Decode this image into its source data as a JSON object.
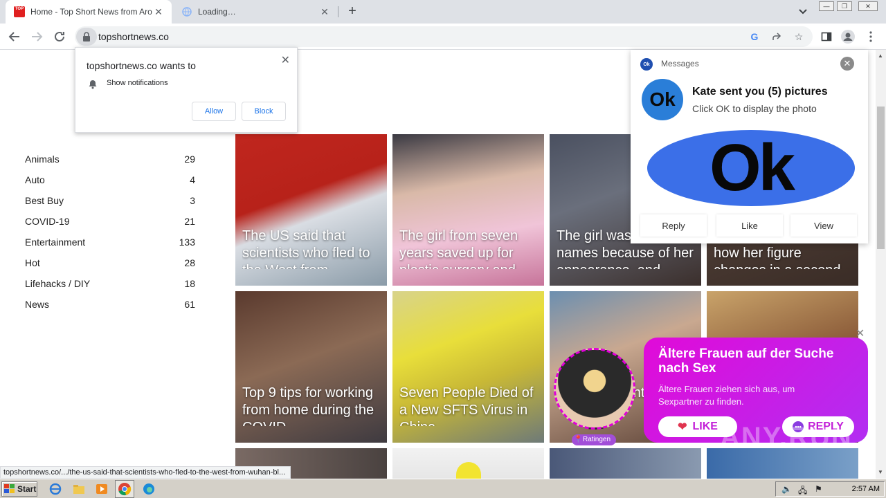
{
  "browser": {
    "tabs": [
      {
        "title": "Home - Top Short News from Around",
        "favicon_text": "TOP"
      },
      {
        "title": "Loading…"
      }
    ],
    "url": "topshortnews.co",
    "status_url": "topshortnews.co/.../the-us-said-that-scientists-who-fled-to-the-west-from-wuhan-bl..."
  },
  "notification_prompt": {
    "title": "topshortnews.co wants to",
    "permission": "Show notifications",
    "allow_label": "Allow",
    "block_label": "Block"
  },
  "categories": [
    {
      "name": "Animals",
      "count": "29"
    },
    {
      "name": "Auto",
      "count": "4"
    },
    {
      "name": "Best Buy",
      "count": "3"
    },
    {
      "name": "COVID-19",
      "count": "21"
    },
    {
      "name": "Entertainment",
      "count": "133"
    },
    {
      "name": "Hot",
      "count": "28"
    },
    {
      "name": "Lifehacks / DIY",
      "count": "18"
    },
    {
      "name": "News",
      "count": "61"
    }
  ],
  "tiles": [
    {
      "caption": "The US said that scientists who fled to the West from"
    },
    {
      "caption": "The girl from seven years saved up for plastic surgery and"
    },
    {
      "caption": "The girl was called names because of her appearance, and"
    },
    {
      "caption": "The blogger showed how her figure changes in a second"
    },
    {
      "caption": "Top 9 tips for working from home during the COVID"
    },
    {
      "caption": "Seven People Died of a New SFTS Virus in China"
    },
    {
      "caption": "Wo... but wanted to"
    },
    {
      "caption": ""
    }
  ],
  "messages_popup": {
    "header": "Messages",
    "avatar_text": "Ok",
    "title": "Kate sent you (5) pictures",
    "subtitle": "Click OK to display the photo",
    "banner_text": "Ok",
    "actions": [
      "Reply",
      "Like",
      "View"
    ]
  },
  "pink_ad": {
    "title": "Ältere Frauen auf der Suche nach Sex",
    "subtitle": "Ältere Frauen ziehen sich aus, um Sexpartner zu finden.",
    "like_label": "LIKE",
    "reply_label": "REPLY",
    "location": "Ratingen"
  },
  "watermark": "ANY.RUN",
  "taskbar": {
    "start_label": "Start",
    "clock": "2:57 AM"
  },
  "colors": {
    "brand_red": "#e02020",
    "link_blue": "#1a73e8",
    "ad_pink": "#e10ad8"
  }
}
